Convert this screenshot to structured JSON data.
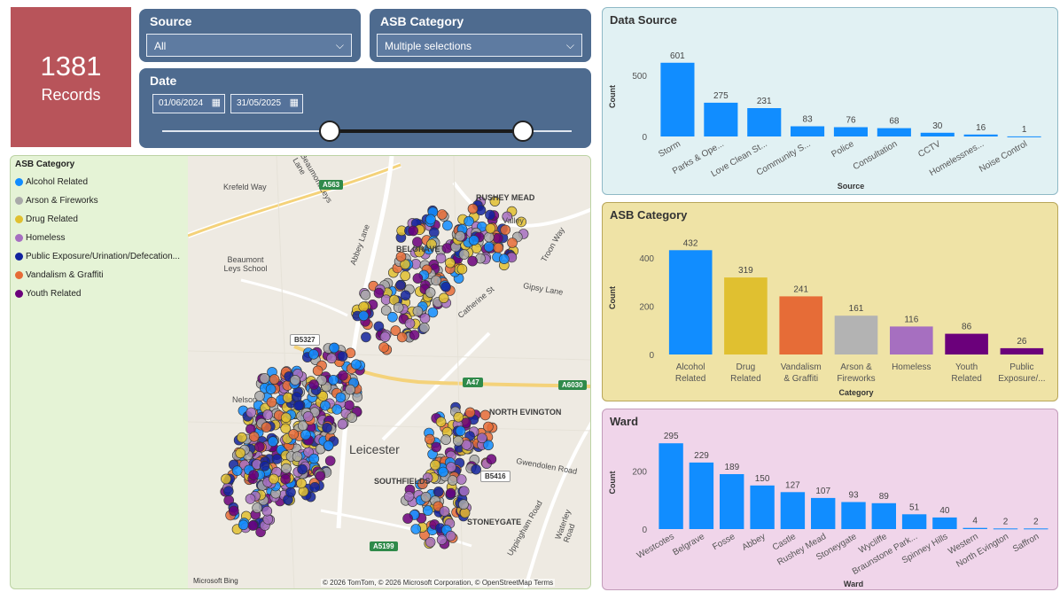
{
  "kpi": {
    "value": "1381",
    "label": "Records"
  },
  "filters": {
    "source": {
      "title": "Source",
      "value": "All"
    },
    "category": {
      "title": "ASB Category",
      "value": "Multiple selections"
    },
    "date": {
      "title": "Date",
      "start": "01/06/2024",
      "end": "31/05/2025",
      "range_selected": [
        0.41,
        0.88
      ]
    }
  },
  "legend": {
    "title": "ASB Category",
    "items": [
      {
        "label": "Alcohol Related",
        "color": "#118dff"
      },
      {
        "label": "Arson & Fireworks",
        "color": "#a9a9a9"
      },
      {
        "label": "Drug Related",
        "color": "#e0c030"
      },
      {
        "label": "Homeless",
        "color": "#a66fc0"
      },
      {
        "label": "Public Exposure/Urination/Defecation...",
        "color": "#12239e"
      },
      {
        "label": "Vandalism & Graffiti",
        "color": "#e66c37"
      },
      {
        "label": "Youth Related",
        "color": "#6b007b"
      }
    ]
  },
  "map": {
    "labels": [
      "Krefeld Way",
      "Beaumont Leys Lane",
      "Abbey Lane",
      "Beaumont Leys School",
      "RUSHEY MEAD",
      "Valley",
      "BELGRAVE",
      "Gipsy Lane",
      "Catherine St",
      "Troon Way",
      "Nelson",
      "Leicester",
      "NORTH EVINGTON",
      "Gwendolen Road",
      "SOUTHFIELDS",
      "STONEYGATE",
      "Waterley Road",
      "Uppingham Road"
    ],
    "shields": [
      "A563",
      "B5327",
      "A47",
      "A6030",
      "A5199",
      "B5416"
    ],
    "bing": "Microsoft Bing",
    "attribution": "© 2026 TomTom, © 2026 Microsoft Corporation, © OpenStreetMap  Terms"
  },
  "charts": {
    "data_source": {
      "title": "Data Source",
      "chart_data": {
        "type": "bar",
        "categories": [
          "Storm",
          "Parks & Ope...",
          "Love Clean St...",
          "Community S...",
          "Police",
          "Consultation",
          "CCTV",
          "Homelessnes...",
          "Noise Control"
        ],
        "values": [
          601,
          275,
          231,
          83,
          76,
          68,
          30,
          16,
          1
        ],
        "xlabel": "Source",
        "ylabel": "Count",
        "yticks": [
          0,
          500
        ],
        "ylim": [
          0,
          650
        ],
        "color": "#118dff"
      }
    },
    "asb_category": {
      "title": "ASB Category",
      "chart_data": {
        "type": "bar",
        "categories": [
          "Alcohol Related",
          "Drug Related",
          "Vandalism & Graffiti",
          "Arson & Fireworks",
          "Homeless",
          "Youth Related",
          "Public Exposure/..."
        ],
        "values": [
          432,
          319,
          241,
          161,
          116,
          86,
          26
        ],
        "colors": [
          "#118dff",
          "#e0c030",
          "#e66c37",
          "#b3b3b3",
          "#a66fc0",
          "#6b007b",
          "#6b007b"
        ],
        "xlabel": "Category",
        "ylabel": "Count",
        "yticks": [
          0,
          200,
          400
        ],
        "ylim": [
          0,
          470
        ]
      }
    },
    "ward": {
      "title": "Ward",
      "chart_data": {
        "type": "bar",
        "categories": [
          "Westcotes",
          "Belgrave",
          "Fosse",
          "Abbey",
          "Castle",
          "Rushey Mead",
          "Stoneygate",
          "Wycliffe",
          "Braunstone Park...",
          "Spinney Hills",
          "Western",
          "North Evington",
          "Saffron"
        ],
        "values": [
          295,
          229,
          189,
          150,
          127,
          107,
          93,
          89,
          51,
          40,
          4,
          2,
          2
        ],
        "xlabel": "Ward",
        "ylabel": "Count",
        "yticks": [
          0,
          200
        ],
        "ylim": [
          0,
          320
        ],
        "color": "#118dff"
      }
    }
  }
}
